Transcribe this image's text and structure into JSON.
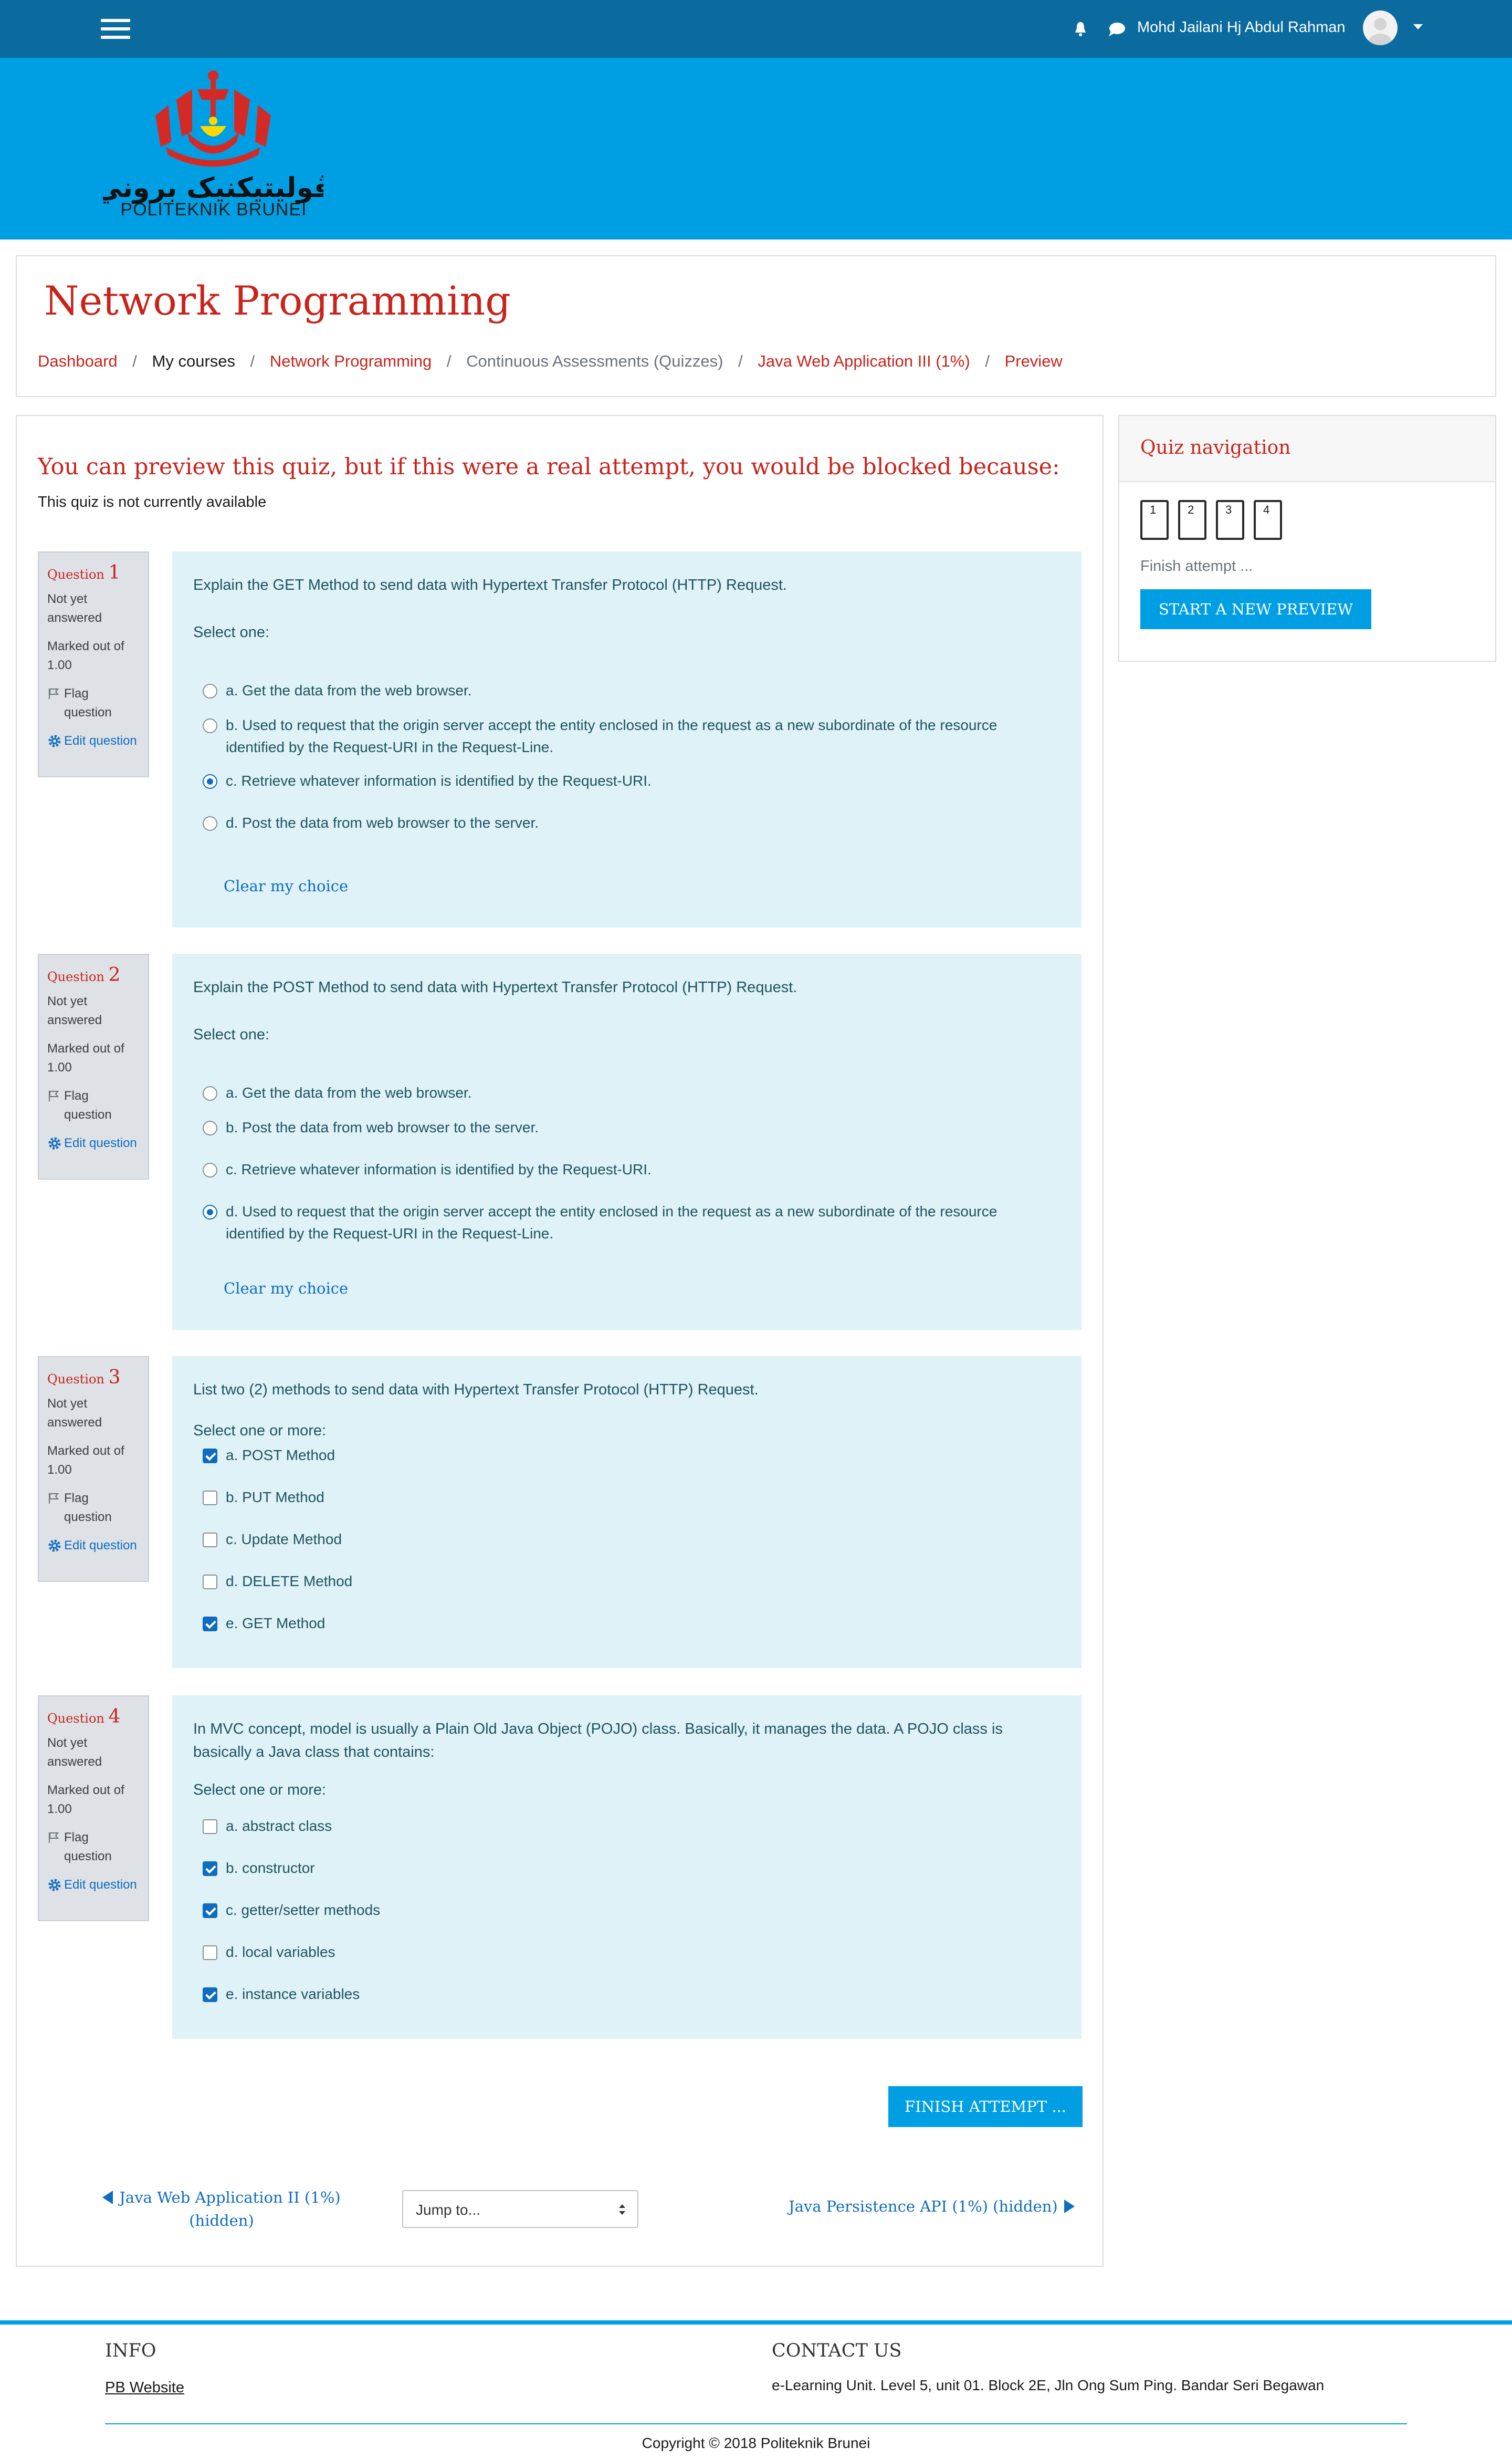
{
  "user": {
    "name": "Mohd Jailani Hj Abdul Rahman"
  },
  "banner": {
    "logo_text": "POLITEKNIK BRUNEI",
    "logo_script": "ڤوليتيکنيک بروني"
  },
  "course": {
    "title": "Network Programming",
    "breadcrumb": [
      {
        "label": "Dashboard",
        "link": true
      },
      {
        "label": "My courses",
        "link": false
      },
      {
        "label": "Network Programming",
        "link": true
      },
      {
        "label": "Continuous Assessments (Quizzes)",
        "link": false
      },
      {
        "label": "Java Web Application III (1%)",
        "link": true
      },
      {
        "label": "Preview",
        "link": true
      }
    ]
  },
  "notice": {
    "title": "You can preview this quiz, but if this were a real attempt, you would be blocked because:",
    "text": "This quiz is not currently available"
  },
  "info_labels": {
    "question": "Question",
    "state": "Not yet answered",
    "marks": "Marked out of 1.00",
    "flag": "Flag question",
    "edit": "Edit question"
  },
  "questions": [
    {
      "number": "1",
      "text": "Explain the GET Method to send data with Hypertext Transfer Protocol (HTTP) Request.",
      "prompt": "Select one:",
      "clear": "Clear my choice",
      "options": [
        {
          "label": "a. Get the data from the web browser.",
          "selected": false
        },
        {
          "label": "b. Used to request that the origin server accept the entity enclosed in the request as a new subordinate of the resource identified by the Request-URI in the Request-Line.",
          "selected": false
        },
        {
          "label": "c. Retrieve whatever information is identified by the Request-URI.",
          "selected": true
        },
        {
          "label": "d. Post the data from web browser to the server.",
          "selected": false
        }
      ]
    },
    {
      "number": "2",
      "text": "Explain the POST Method to send data with Hypertext Transfer Protocol (HTTP) Request.",
      "prompt": "Select one:",
      "clear": "Clear my choice",
      "options": [
        {
          "label": "a. Get the data from the web browser.",
          "selected": false
        },
        {
          "label": "b. Post the data from web browser to the server.",
          "selected": false
        },
        {
          "label": "c. Retrieve whatever information is identified by the Request-URI.",
          "selected": false
        },
        {
          "label": "d. Used to request that the origin server accept the entity enclosed in the request as a new subordinate of the resource identified by the Request-URI in the Request-Line.",
          "selected": true
        }
      ]
    },
    {
      "number": "3",
      "text": "List two (2) methods to send data with Hypertext Transfer Protocol (HTTP) Request.",
      "prompt": "Select one or more:",
      "options": [
        {
          "label": "a. POST Method",
          "selected": true
        },
        {
          "label": "b. PUT Method",
          "selected": false
        },
        {
          "label": "c. Update Method",
          "selected": false
        },
        {
          "label": "d. DELETE Method",
          "selected": false
        },
        {
          "label": "e. GET Method",
          "selected": true
        }
      ]
    },
    {
      "number": "4",
      "text": "In MVC concept, model is usually a Plain Old Java Object (POJO) class. Basically, it manages the data. A POJO class is basically a Java class that contains:",
      "prompt": "Select one or more:",
      "options": [
        {
          "label": "a. abstract class",
          "selected": false
        },
        {
          "label": "b. constructor",
          "selected": true
        },
        {
          "label": "c. getter/setter methods",
          "selected": true
        },
        {
          "label": "d. local variables",
          "selected": false
        },
        {
          "label": "e. instance variables",
          "selected": true
        }
      ]
    }
  ],
  "actions": {
    "finish": "FINISH ATTEMPT ..."
  },
  "pager": {
    "prev": "Java Web Application II (1%) (hidden)",
    "jump": "Jump to...",
    "next": "Java Persistence API (1%) (hidden)"
  },
  "quiz_nav": {
    "title": "Quiz navigation",
    "numbers": [
      "1",
      "2",
      "3",
      "4"
    ],
    "finish": "Finish attempt ...",
    "start": "START A NEW PREVIEW"
  },
  "footer": {
    "info_title": "INFO",
    "pb_link": "PB Website",
    "contact_title": "CONTACT US",
    "contact_text": "e-Learning Unit. Level 5, unit 01. Block 2E, Jln Ong Sum Ping. Bandar Seri Begawan",
    "copyright": "Copyright © 2018 Politeknik Brunei"
  },
  "colors": {
    "navbar": "#0b6b9e",
    "banner": "#009fe3",
    "accent_red": "#c8241b",
    "link_blue": "#0f6cbf",
    "question_bg": "#def2f8"
  }
}
